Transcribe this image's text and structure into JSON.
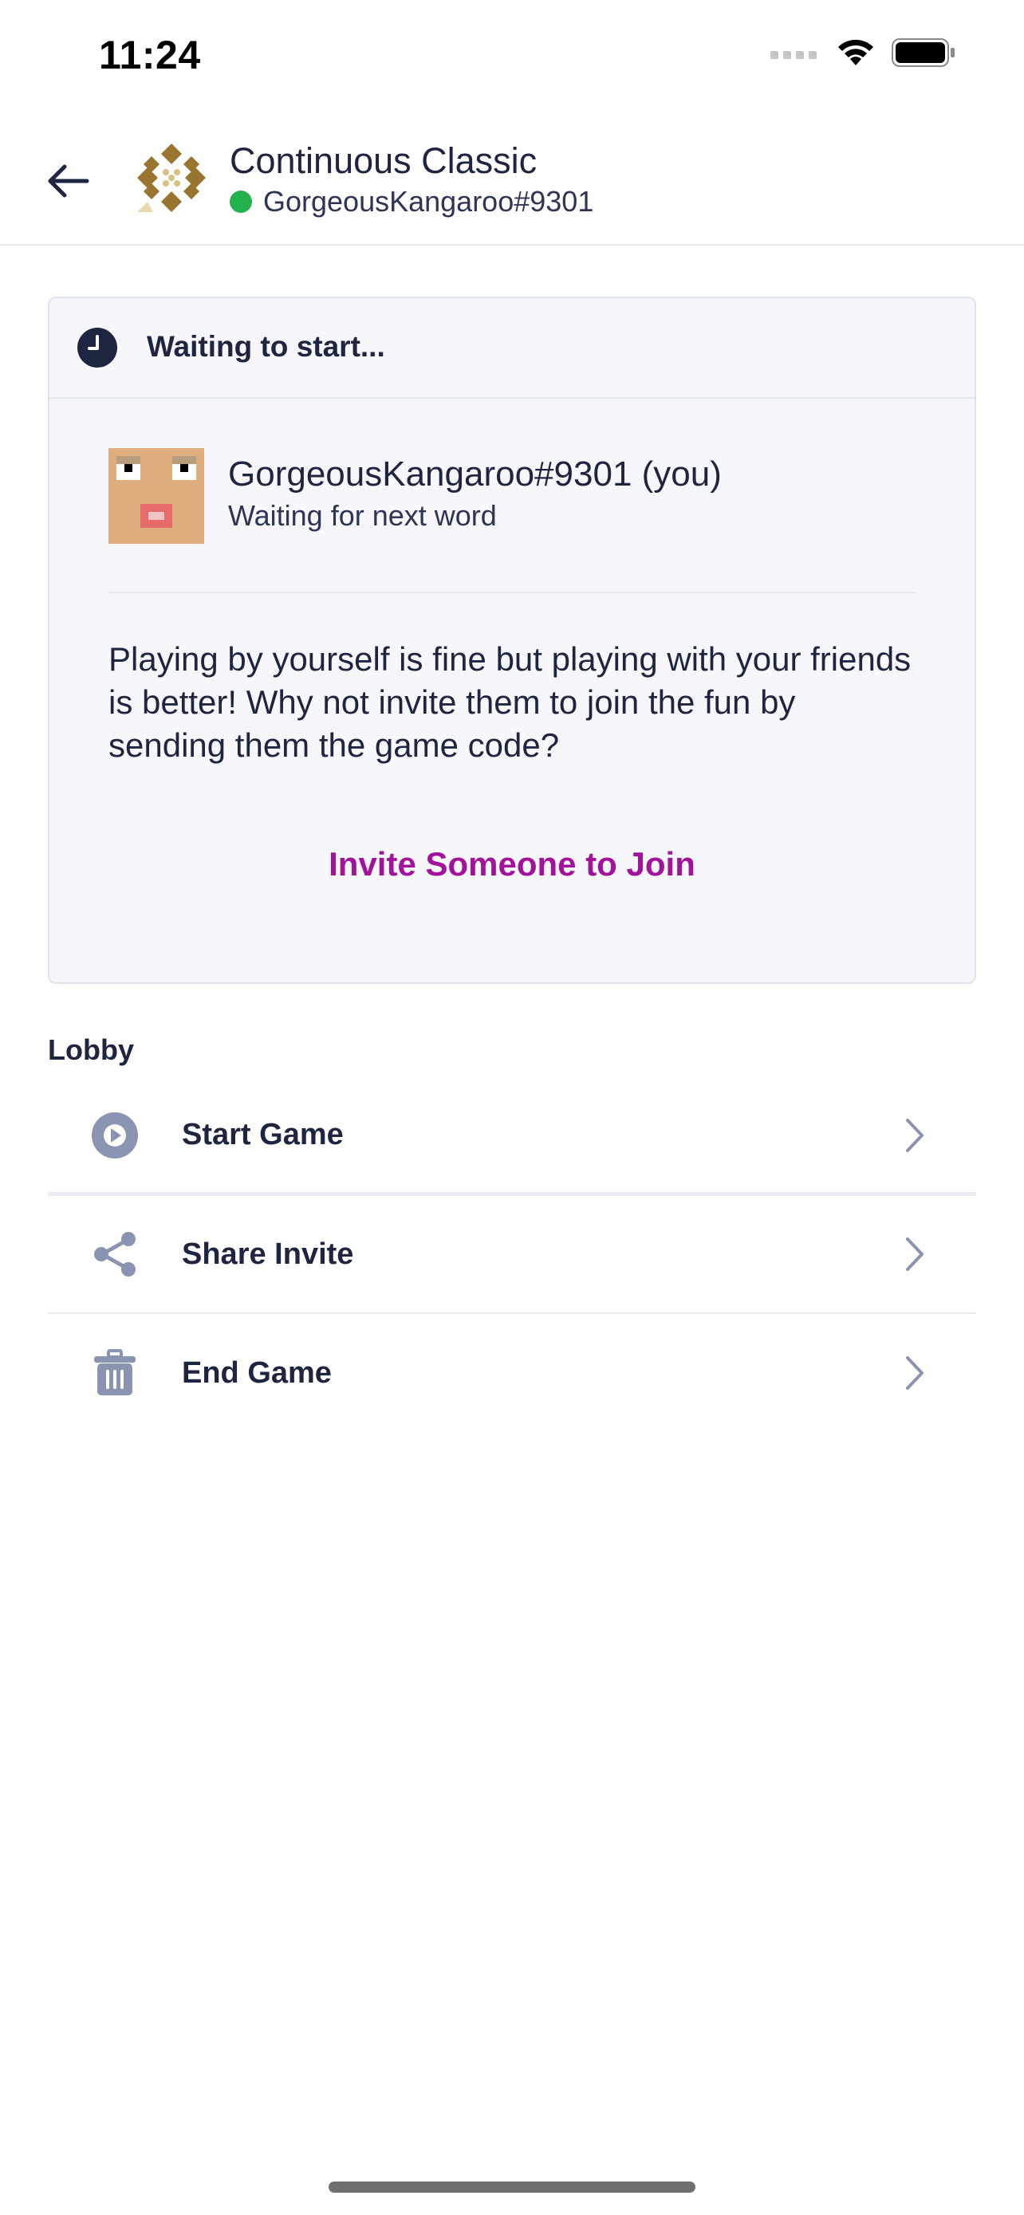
{
  "status_bar": {
    "time": "11:24"
  },
  "header": {
    "title": "Continuous Classic",
    "subtitle": "GorgeousKangaroo#9301",
    "online_color": "#22b14c"
  },
  "status_card": {
    "heading": "Waiting to start...",
    "player": {
      "name": "GorgeousKangaroo#9301 (you)",
      "status": "Waiting for next word"
    },
    "message": "Playing by yourself is fine but playing with your friends is better! Why not invite them to join the fun by sending them the game code?",
    "invite_label": "Invite Someone to Join",
    "invite_color": "#a2129a"
  },
  "lobby": {
    "label": "Lobby",
    "items": [
      {
        "label": "Start Game",
        "icon": "play-circle-icon"
      },
      {
        "label": "Share Invite",
        "icon": "share-icon"
      },
      {
        "label": "End Game",
        "icon": "trash-icon"
      }
    ]
  }
}
